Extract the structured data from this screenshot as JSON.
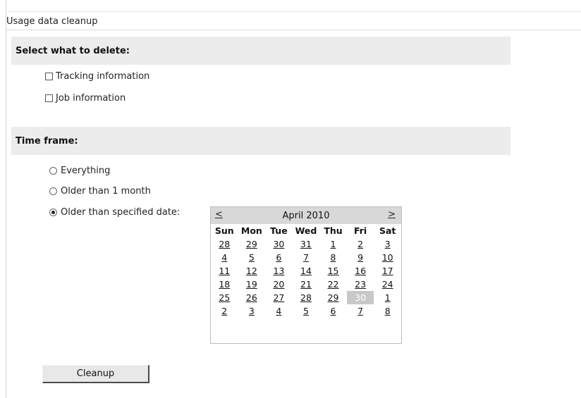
{
  "page": {
    "title": "Usage data cleanup"
  },
  "delete_section": {
    "header": "Select what to delete:",
    "options": [
      {
        "label": "Tracking information",
        "checked": false
      },
      {
        "label": "Job information",
        "checked": false
      }
    ]
  },
  "time_section": {
    "header": "Time frame:",
    "options": [
      {
        "label": "Everything",
        "selected": false
      },
      {
        "label": "Older than 1 month",
        "selected": false
      },
      {
        "label": "Older than specified date:",
        "selected": true
      }
    ]
  },
  "calendar": {
    "month_label": "April 2010",
    "prev_label": "<",
    "next_label": ">",
    "weekdays": [
      "Sun",
      "Mon",
      "Tue",
      "Wed",
      "Thu",
      "Fri",
      "Sat"
    ],
    "weeks": [
      [
        "28",
        "29",
        "30",
        "31",
        "1",
        "2",
        "3"
      ],
      [
        "4",
        "5",
        "6",
        "7",
        "8",
        "9",
        "10"
      ],
      [
        "11",
        "12",
        "13",
        "14",
        "15",
        "16",
        "17"
      ],
      [
        "18",
        "19",
        "20",
        "21",
        "22",
        "23",
        "24"
      ],
      [
        "25",
        "26",
        "27",
        "28",
        "29",
        "30",
        "1"
      ],
      [
        "2",
        "3",
        "4",
        "5",
        "6",
        "7",
        "8"
      ]
    ],
    "selected_date": "30",
    "colors": {
      "header_bg": "#d8d8d8",
      "selected_bg": "#c8c8c8"
    }
  },
  "actions": {
    "cleanup_label": "Cleanup"
  }
}
